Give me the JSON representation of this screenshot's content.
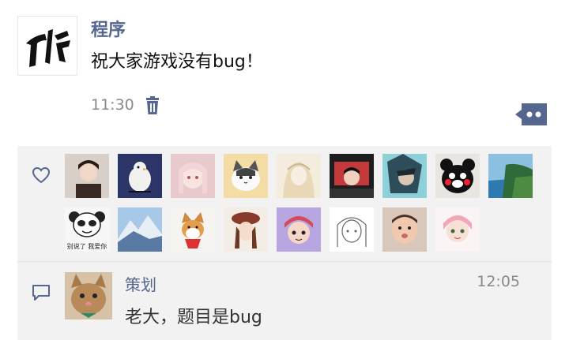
{
  "post": {
    "author": "程序",
    "content": "祝大家游戏没有bug！",
    "time": "11:30"
  },
  "icons": {
    "delete": "trash-icon",
    "more": "more-dots-icon",
    "like": "heart-icon",
    "comment": "comment-icon"
  },
  "likes": {
    "row1": [
      "avatar-girl",
      "avatar-bird",
      "avatar-anime-girl",
      "avatar-cat",
      "avatar-sketch-girl",
      "avatar-red-character",
      "avatar-warrior",
      "avatar-kumamon",
      "avatar-coast"
    ],
    "row2": [
      "avatar-panda-meme",
      "avatar-mountain",
      "avatar-shiba",
      "avatar-hat-girl",
      "avatar-cartoon",
      "avatar-line-girl",
      "avatar-baby",
      "avatar-pink-girl"
    ]
  },
  "comment": {
    "author": "策划",
    "time": "12:05",
    "text": "老大，题目是bug",
    "panda_caption": "别说了 我爱你"
  }
}
